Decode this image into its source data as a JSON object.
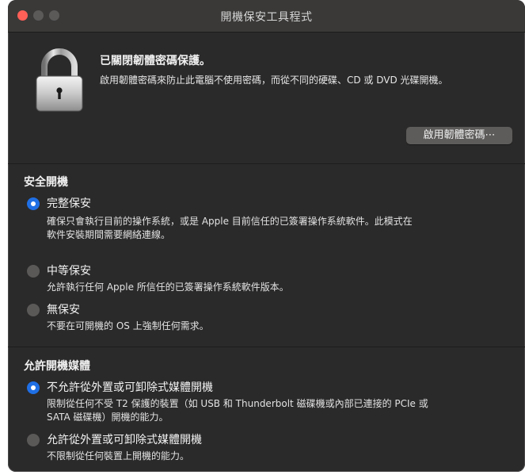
{
  "window": {
    "title": "開機保安工具程式"
  },
  "firmware": {
    "heading": "已關閉韌體密碼保護。",
    "description": "啟用韌體密碼來防止此電腦不使用密碼，而從不同的硬碟、CD 或 DVD 光碟開機。",
    "button_label": "啟用韌體密碼⋯",
    "icon": "lock-icon"
  },
  "secure_boot": {
    "title": "安全開機",
    "options": [
      {
        "label": "完整保安",
        "selected": true,
        "desc_line1": "確保只會執行目前的操作系統，或是 Apple 目前信任的已簽署操作系統軟件。此模式在",
        "desc_line2": "軟件安裝期間需要網絡連線。"
      },
      {
        "label": "中等保安",
        "selected": false,
        "desc_line1": "允許執行任何 Apple 所信任的已簽署操作系統軟件版本。"
      },
      {
        "label": "無保安",
        "selected": false,
        "desc_line1": "不要在可開機的 OS 上強制任何需求。"
      }
    ]
  },
  "boot_media": {
    "title": "允許開機媒體",
    "options": [
      {
        "label": "不允許從外置或可卸除式媒體開機",
        "selected": true,
        "desc_line1": "限制從任何不受 T2 保護的裝置（如 USB 和 Thunderbolt 磁碟機或內部已連接的 PCIe 或",
        "desc_line2": "SATA 磁碟機）開機的能力。"
      },
      {
        "label": "允許從外置或可卸除式媒體開機",
        "selected": false,
        "desc_line1": "不限制從任何裝置上開機的能力。"
      }
    ]
  },
  "colors": {
    "window_bg": "#2b2a2a",
    "accent": "#1f6fe5",
    "close_light": "#fe5f57"
  }
}
